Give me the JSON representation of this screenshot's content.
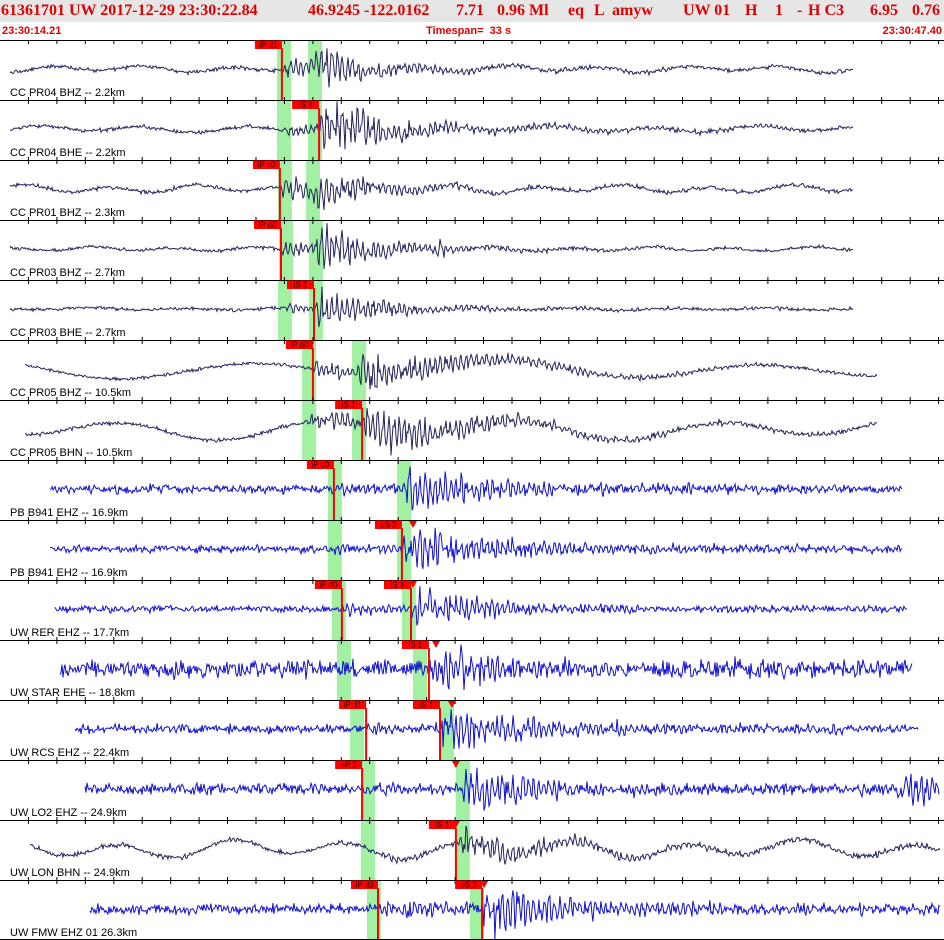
{
  "header": {
    "event_fields": [
      "61361701 UW 2017-12-29 23:30:22.84",
      "46.9245 -122.0162",
      "7.71",
      "0.96 Ml",
      "eq",
      "L",
      "amyw",
      "UW 01",
      "H",
      "1",
      "-",
      "H C3",
      "6.95",
      "0.76"
    ],
    "start_time": "23:30:14.21",
    "timespan": "Timespan=  33 s",
    "end_time": "23:30:47.40"
  },
  "colors": {
    "header_text": "#e00000",
    "pick": "#ff0000",
    "pick_text": "#3a0000",
    "predicted_window": "#a2f0a2",
    "axis": "#000000",
    "station_label": "#000000"
  },
  "chart_data": {
    "type": "line",
    "xlim": [
      "23:30:14.21",
      "23:30:47.40"
    ],
    "traces": [
      {
        "label": "CC PR04 BHZ -- 2.2km",
        "color": "#24245c",
        "t_start": "23:30:14.56",
        "t_end": "23:30:44.20",
        "predicted_p": "23:30:23.95",
        "predicted_s": "23:30:25.04",
        "picks": [
          {
            "label": "iP d1",
            "time": "23:30:24.12"
          }
        ],
        "markers": []
      },
      {
        "label": "CC PR04 BHE -- 2.2km",
        "color": "#24245c",
        "t_start": "23:30:14.56",
        "t_end": "23:30:44.20",
        "predicted_p": "23:30:23.95",
        "predicted_s": "23:30:25.04",
        "picks": [
          {
            "label": "iS 1",
            "time": "23:30:25.43"
          }
        ],
        "markers": []
      },
      {
        "label": "CC PR01 BHZ -- 2.3km",
        "color": "#24245c",
        "t_start": "23:30:14.56",
        "t_end": "23:30:44.20",
        "predicted_p": "23:30:23.98",
        "predicted_s": "23:30:24.97",
        "picks": [
          {
            "label": "iP c0",
            "time": "23:30:24.05"
          }
        ],
        "markers": []
      },
      {
        "label": "CC PR03 BHZ -- 2.7km",
        "color": "#24245c",
        "t_start": "23:30:14.56",
        "t_end": "23:30:44.20",
        "predicted_p": "23:30:24.02",
        "predicted_s": "23:30:25.07",
        "picks": [
          {
            "label": "iP d0",
            "time": "23:30:24.09"
          }
        ],
        "markers": []
      },
      {
        "label": "CC PR03 BHE -- 2.7km",
        "color": "#24245c",
        "t_start": "23:30:14.56",
        "t_end": "23:30:44.20",
        "predicted_p": "23:30:23.98",
        "predicted_s": "23:30:25.07",
        "picks": [
          {
            "label": "iS 1",
            "time": "23:30:25.25"
          }
        ],
        "markers": []
      },
      {
        "label": "CC PR05 BHZ -- 10.5km",
        "color": "#24245c",
        "t_start": "23:30:15.09",
        "t_end": "23:30:45.08",
        "predicted_p": "23:30:24.83",
        "predicted_s": "23:30:26.59",
        "picks": [
          {
            "label": "iP d0",
            "time": "23:30:25.21"
          }
        ],
        "markers": []
      },
      {
        "label": "CC PR05 BHN -- 10.5km",
        "color": "#24245c",
        "t_start": "23:30:15.09",
        "t_end": "23:30:45.08",
        "predicted_p": "23:30:24.83",
        "predicted_s": "23:30:26.59",
        "picks": [
          {
            "label": "iS 1",
            "time": "23:30:26.94"
          }
        ],
        "markers": []
      },
      {
        "label": "PB B941 EHZ -- 16.9km",
        "color": "#1010d0",
        "t_start": "23:30:15.97",
        "t_end": "23:30:45.96",
        "predicted_p": "23:30:25.74",
        "predicted_s": "23:30:28.17",
        "picks": [
          {
            "label": "iP c0",
            "time": "23:30:25.95"
          }
        ],
        "markers": []
      },
      {
        "label": "PB B941 EH2 -- 16.9km",
        "color": "#1010d0",
        "t_start": "23:30:15.97",
        "t_end": "23:30:45.96",
        "predicted_p": "23:30:25.74",
        "predicted_s": "23:30:28.17",
        "picks": [
          {
            "label": "eS 2",
            "time": "23:30:28.34"
          }
        ],
        "markers": [
          "23:30:28.73"
        ]
      },
      {
        "label": "UW RER EHZ -- 17.7km",
        "color": "#1010d0",
        "t_start": "23:30:16.14",
        "t_end": "23:30:46.10",
        "predicted_p": "23:30:25.88",
        "predicted_s": "23:30:28.34",
        "picks": [
          {
            "label": "iP d0",
            "time": "23:30:26.23"
          },
          {
            "label": "iS 1",
            "time": "23:30:28.66"
          }
        ],
        "markers": [
          "23:30:28.73"
        ]
      },
      {
        "label": "UW STAR EHE -- 18.8km",
        "color": "#1010d0",
        "t_start": "23:30:16.32",
        "t_end": "23:30:46.28",
        "predicted_p": "23:30:26.06",
        "predicted_s": "23:30:28.73",
        "picks": [
          {
            "label": "iS 1",
            "time": "23:30:29.29"
          }
        ],
        "markers": [
          "23:30:29.54"
        ]
      },
      {
        "label": "UW RCS EHZ -- 22.4km",
        "color": "#1010d0",
        "t_start": "23:30:16.85",
        "t_end": "23:30:46.49",
        "predicted_p": "23:30:26.52",
        "predicted_s": "23:30:29.68",
        "picks": [
          {
            "label": "iP d1",
            "time": "23:30:27.08"
          },
          {
            "label": "iS 1",
            "time": "23:30:29.68"
          }
        ],
        "markers": [
          "23:30:30.10"
        ]
      },
      {
        "label": "UW LO2 EHZ -- 24.9km",
        "color": "#1010d0",
        "t_start": "23:30:17.20",
        "t_end": "23:30:47.26",
        "predicted_p": "23:30:26.90",
        "predicted_s": "23:30:30.24",
        "picks": [
          {
            "label": "eP 2",
            "time": "23:30:26.94"
          }
        ],
        "markers": [
          "23:30:30.24"
        ]
      },
      {
        "label": "UW LON BHN -- 24.9km",
        "color": "#24245c",
        "t_start": "23:30:15.26",
        "t_end": "23:30:47.26",
        "predicted_p": "23:30:26.90",
        "predicted_s": "23:30:30.24",
        "picks": [
          {
            "label": "iS 1",
            "time": "23:30:30.24"
          }
        ],
        "markers": [
          "23:30:30.24"
        ]
      },
      {
        "label": "UW FMW EHZ 01 26.3km",
        "color": "#1010d0",
        "t_start": "23:30:17.37",
        "t_end": "23:30:47.26",
        "predicted_p": "23:30:27.11",
        "predicted_s": "23:30:30.73",
        "picks": [
          {
            "label": "iP d0",
            "time": "23:30:27.50"
          },
          {
            "label": "eS 2",
            "time": "23:30:31.16"
          }
        ],
        "markers": [
          "23:30:31.23"
        ]
      }
    ]
  }
}
